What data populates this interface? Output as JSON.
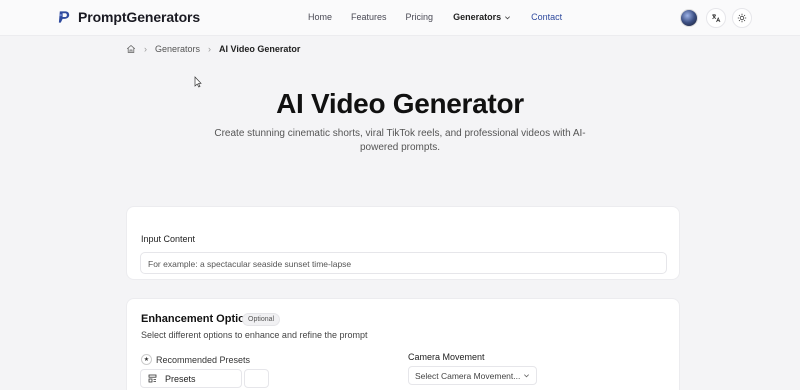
{
  "header": {
    "brand": "PromptGenerators",
    "nav": {
      "home": "Home",
      "features": "Features",
      "pricing": "Pricing",
      "generators": "Generators",
      "contact": "Contact"
    }
  },
  "breadcrumb": {
    "parent": "Generators",
    "current": "AI Video Generator"
  },
  "hero": {
    "title": "AI Video Generator",
    "subtitle": "Create stunning cinematic shorts, viral TikTok reels, and professional videos with AI-powered prompts."
  },
  "input_card": {
    "label": "Input Content",
    "placeholder": "For example: a spectacular seaside sunset time-lapse"
  },
  "enhancement": {
    "title": "Enhancement Options",
    "badge": "Optional",
    "description": "Select different options to enhance and refine the prompt",
    "recommended_label": "Recommended Presets",
    "presets_button": "Presets",
    "camera_label": "Camera Movement",
    "camera_placeholder": "Select Camera Movement..."
  },
  "colors": {
    "accent": "#2f4a9e",
    "background": "#f4f4f6"
  }
}
